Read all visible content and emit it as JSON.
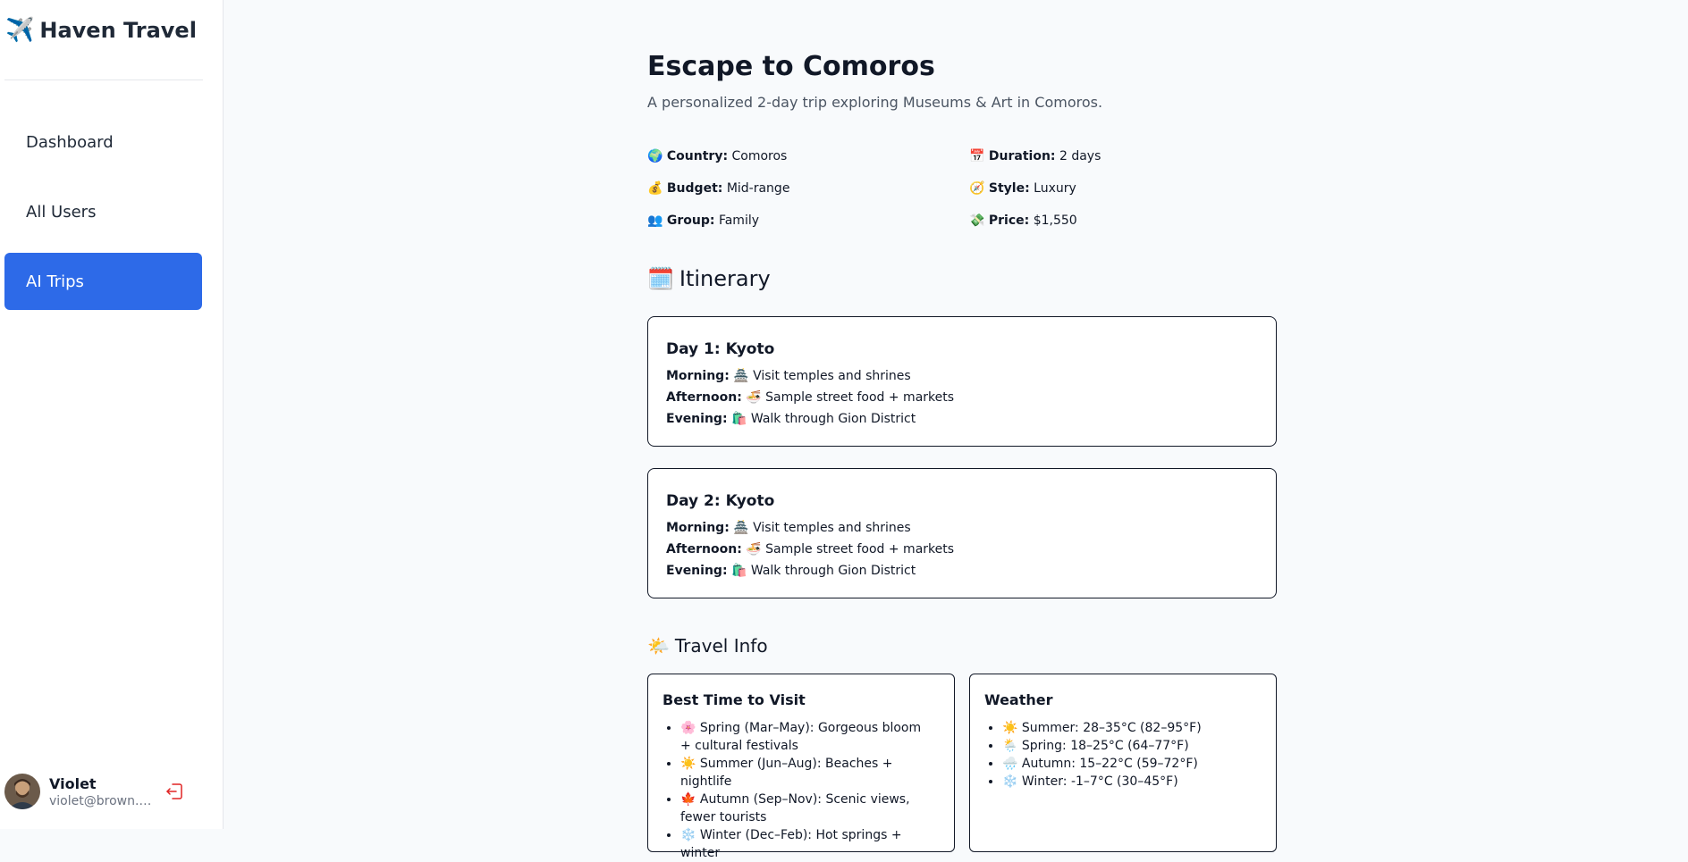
{
  "sidebar": {
    "brand": {
      "icon": "✈️",
      "name": "Haven Travel"
    },
    "nav": [
      {
        "label": "Dashboard",
        "active": false
      },
      {
        "label": "All Users",
        "active": false
      },
      {
        "label": "AI Trips",
        "active": true
      }
    ],
    "user": {
      "name": "Violet",
      "email": "violet@brown.co...",
      "logout_icon": "logout-icon"
    }
  },
  "trip": {
    "title": "Escape to Comoros",
    "subtitle": "A personalized 2-day trip exploring Museums & Art in Comoros.",
    "facts": [
      {
        "icon": "🌍",
        "label": "Country:",
        "value": "Comoros"
      },
      {
        "icon": "📅",
        "label": "Duration:",
        "value": "2 days"
      },
      {
        "icon": "💰",
        "label": "Budget:",
        "value": "Mid-range"
      },
      {
        "icon": "🧭",
        "label": "Style:",
        "value": "Luxury"
      },
      {
        "icon": "👥",
        "label": "Group:",
        "value": "Family"
      },
      {
        "icon": "💸",
        "label": "Price:",
        "value": "$1,550"
      }
    ]
  },
  "itinerary": {
    "icon": "🗓️",
    "title": "Itinerary",
    "days": [
      {
        "title": "Day 1: Kyoto",
        "lines": [
          {
            "label": "Morning:",
            "text": "🏯 Visit temples and shrines"
          },
          {
            "label": "Afternoon:",
            "text": "🍜 Sample street food + markets"
          },
          {
            "label": "Evening:",
            "text": "🛍️ Walk through Gion District"
          }
        ]
      },
      {
        "title": "Day 2: Kyoto",
        "lines": [
          {
            "label": "Morning:",
            "text": "🏯 Visit temples and shrines"
          },
          {
            "label": "Afternoon:",
            "text": "🍜 Sample street food + markets"
          },
          {
            "label": "Evening:",
            "text": "🛍️ Walk through Gion District"
          }
        ]
      }
    ]
  },
  "travel_info": {
    "icon": "🌤️",
    "title": "Travel Info",
    "best_time": {
      "title": "Best Time to Visit",
      "items": [
        "🌸 Spring (Mar–May): Gorgeous bloom + cultural festivals",
        "☀️ Summer (Jun–Aug): Beaches + nightlife",
        "🍁 Autumn (Sep–Nov): Scenic views, fewer tourists",
        "❄️ Winter (Dec–Feb): Hot springs + winter"
      ]
    },
    "weather": {
      "title": "Weather",
      "items": [
        "☀️ Summer: 28–35°C (82–95°F)",
        "🌦️ Spring: 18–25°C (64–77°F)",
        "🌧️ Autumn: 15–22°C (59–72°F)",
        "❄️ Winter: -1–7°C (30–45°F)"
      ]
    }
  },
  "colors": {
    "accent": "#2d6ae8",
    "logout": "#e02424",
    "card_border": "#111827"
  }
}
